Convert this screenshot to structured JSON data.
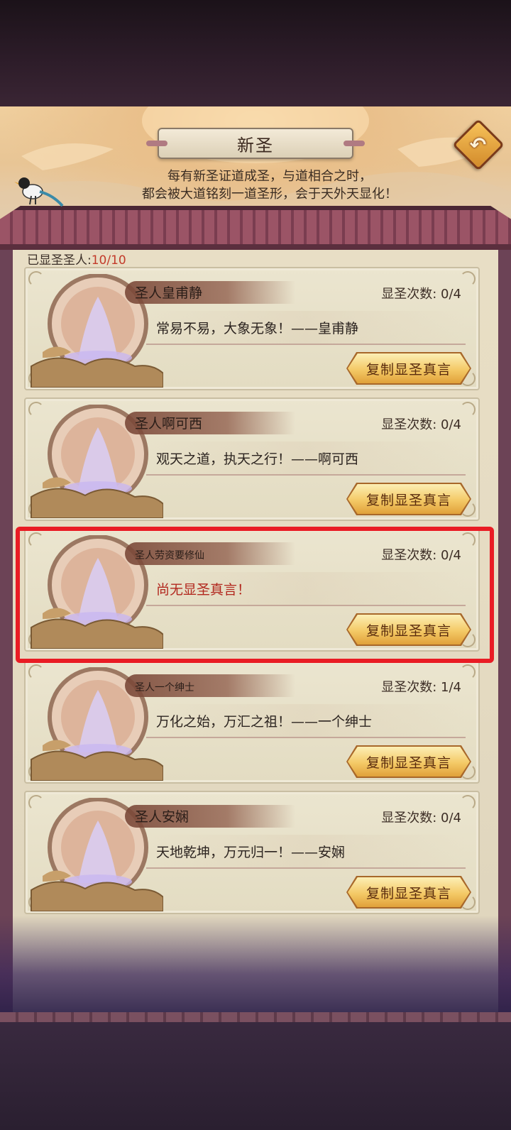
{
  "header": {
    "title": "新圣",
    "back_icon": "↶",
    "subtitle_line1": "每有新圣证道成圣，与道相合之时，",
    "subtitle_line2": "都会被大道铭刻一道圣形，会于天外天显化！"
  },
  "summary": {
    "label": "已显圣圣人:",
    "value": "10/10"
  },
  "saints": [
    {
      "name": "圣人皇甫静",
      "count": "显圣次数: 0/4",
      "quote": "常易不易，大象无象！——皇甫静",
      "button": "复制显圣真言"
    },
    {
      "name": "圣人啊可西",
      "count": "显圣次数: 0/4",
      "quote": "观天之道，执天之行！——啊可西",
      "button": "复制显圣真言"
    },
    {
      "name": "圣人劳资要修仙",
      "count": "显圣次数: 0/4",
      "quote": "尚无显圣真言！",
      "button": "复制显圣真言"
    },
    {
      "name": "圣人一个绅士",
      "count": "显圣次数: 1/4",
      "quote": "万化之始，万汇之祖！——一个绅士",
      "button": "复制显圣真言"
    },
    {
      "name": "圣人安娴",
      "count": "显圣次数: 0/4",
      "quote": "天地乾坤，万元归一！——安娴",
      "button": "复制显圣真言"
    }
  ],
  "colors": {
    "highlight": "#e91c24",
    "empty_quote": "#b2281e",
    "count_value": "#c23a2a"
  }
}
